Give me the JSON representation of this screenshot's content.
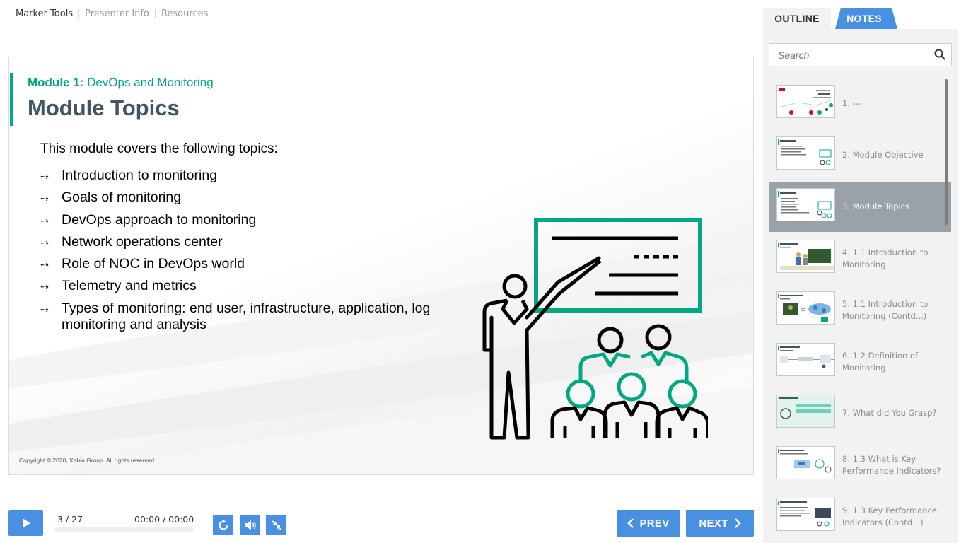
{
  "top_tabs": [
    {
      "label": "Marker Tools",
      "active": true
    },
    {
      "label": "Presenter Info",
      "active": false
    },
    {
      "label": "Resources",
      "active": false
    }
  ],
  "slide": {
    "module_prefix": "Module 1:",
    "module_name": " DevOps and Monitoring",
    "title": "Module Topics",
    "intro": "This module covers the following topics:",
    "bullet_glyph": "⤑",
    "topics": [
      "Introduction to monitoring",
      "Goals of monitoring",
      "DevOps approach to monitoring",
      "Network operations center",
      "Role of NOC in DevOps world",
      "Telemetry and metrics",
      "Types of monitoring: end user, infrastructure, application, log monitoring and analysis"
    ],
    "copyright": "Copyright © 2020, Xebia Group. All rights reserved.",
    "illustration": "presenter-with-audience-icon"
  },
  "player": {
    "counter": "3 / 27",
    "timecode": "00:00 / 00:00",
    "progress": 0,
    "prev_label": "PREV",
    "next_label": "NEXT",
    "play_icon": "play-icon",
    "replay_icon": "replay-icon",
    "volume_icon": "volume-icon",
    "collapse_icon": "collapse-icon"
  },
  "sidebar": {
    "tabs": [
      {
        "label": "OUTLINE",
        "active": false
      },
      {
        "label": "NOTES",
        "active": true
      }
    ],
    "search_placeholder": "Search",
    "items": [
      {
        "label": "1. ---",
        "active": false
      },
      {
        "label": "2. Module Objective",
        "active": false
      },
      {
        "label": "3. Module Topics",
        "active": true
      },
      {
        "label": "4. 1.1 Introduction to Monitoring",
        "active": false
      },
      {
        "label": "5. 1.1 Introduction to Monitoring (Contd...)",
        "active": false
      },
      {
        "label": "6. 1.2 Definition of Monitoring",
        "active": false
      },
      {
        "label": "7. What did You Grasp?",
        "active": false
      },
      {
        "label": "8. 1.3 What is Key Performance Indicators?",
        "active": false
      },
      {
        "label": "9. 1.3 Key Performance Indicators (Contd...)",
        "active": false
      }
    ]
  },
  "colors": {
    "accent_green": "#01a982",
    "title_slate": "#425563",
    "button_blue": "#4a90e2",
    "active_item": "#9aa2a9"
  }
}
